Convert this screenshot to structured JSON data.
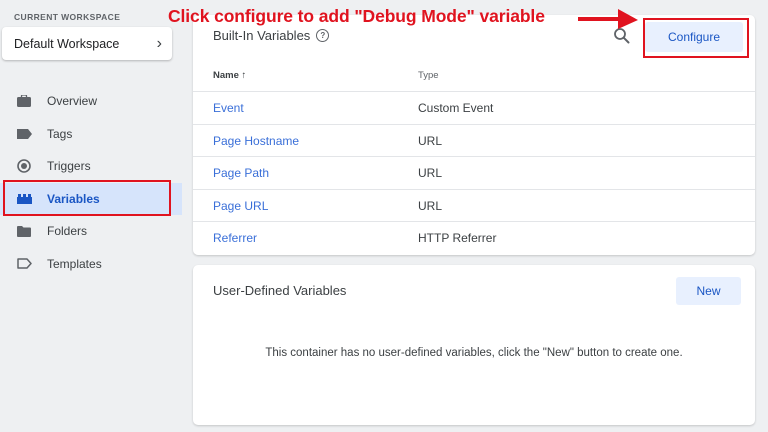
{
  "sidebar": {
    "workspace_label": "CURRENT WORKSPACE",
    "workspace_name": "Default Workspace",
    "items": [
      {
        "label": "Overview",
        "icon": "briefcase-icon"
      },
      {
        "label": "Tags",
        "icon": "tag-icon"
      },
      {
        "label": "Triggers",
        "icon": "target-icon"
      },
      {
        "label": "Variables",
        "icon": "blocks-icon",
        "active": true
      },
      {
        "label": "Folders",
        "icon": "folder-icon"
      },
      {
        "label": "Templates",
        "icon": "template-icon"
      }
    ]
  },
  "annotation": {
    "text": "Click configure to add \"Debug Mode\" variable",
    "color": "#e0131f"
  },
  "builtin": {
    "title": "Built-In Variables",
    "configure_label": "Configure",
    "columns": {
      "name": "Name ↑",
      "type": "Type"
    },
    "rows": [
      {
        "name": "Event",
        "type": "Custom Event"
      },
      {
        "name": "Page Hostname",
        "type": "URL"
      },
      {
        "name": "Page Path",
        "type": "URL"
      },
      {
        "name": "Page URL",
        "type": "URL"
      },
      {
        "name": "Referrer",
        "type": "HTTP Referrer"
      }
    ]
  },
  "user_defined": {
    "title": "User-Defined Variables",
    "new_label": "New",
    "empty_message": "This container has no user-defined variables, click the \"New\" button to create one."
  },
  "colors": {
    "accent": "#1a56c4",
    "link": "#3a6fd8",
    "highlight": "#e0131f",
    "active_bg": "#d6e4fb"
  }
}
